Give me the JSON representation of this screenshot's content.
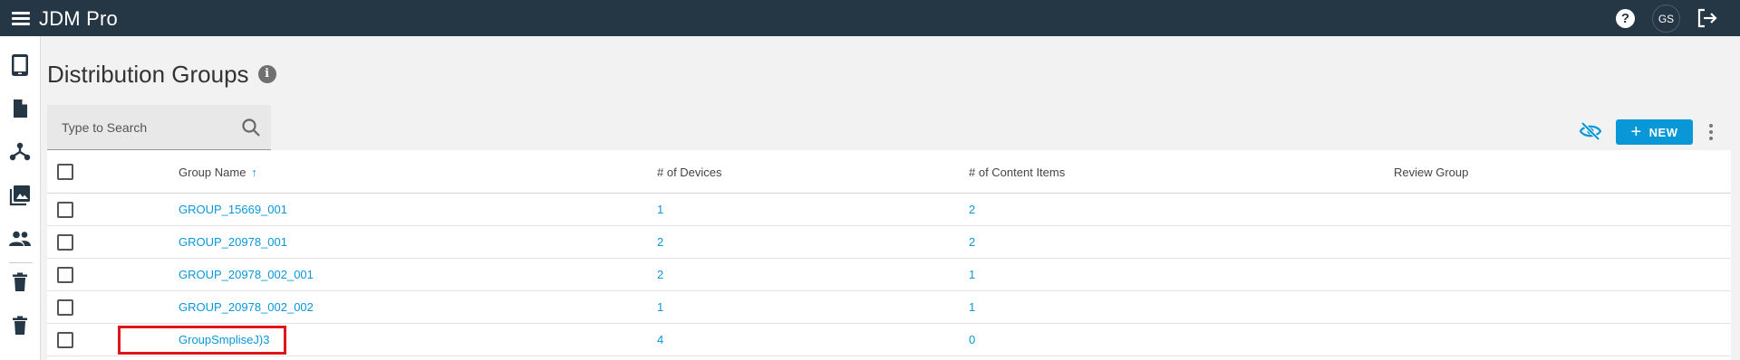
{
  "app": {
    "title": "JDM Pro",
    "avatar_initials": "GS",
    "help_label": "?"
  },
  "sidebar": {
    "items": [
      {
        "name": "devices",
        "icon": "tablet-icon"
      },
      {
        "name": "content",
        "icon": "document-icon"
      },
      {
        "name": "distribution-groups",
        "icon": "hierarchy-icon"
      },
      {
        "name": "media",
        "icon": "photo-library-icon"
      },
      {
        "name": "users",
        "icon": "people-icon"
      },
      {
        "name": "trash-1",
        "icon": "trash-icon"
      },
      {
        "name": "trash-2",
        "icon": "trash-icon"
      }
    ]
  },
  "page": {
    "title": "Distribution Groups",
    "info_label": "i"
  },
  "search": {
    "placeholder": "Type to Search",
    "value": ""
  },
  "toolbar": {
    "new_label": "NEW"
  },
  "table": {
    "headers": {
      "name": "Group Name",
      "devices": "# of Devices",
      "content": "# of Content Items",
      "review": "Review Group"
    },
    "sort": {
      "column": "Group Name",
      "direction": "ascending"
    },
    "rows": [
      {
        "name": "GROUP_15669_001",
        "devices": "1",
        "content": "2",
        "review": ""
      },
      {
        "name": "GROUP_20978_001",
        "devices": "2",
        "content": "2",
        "review": ""
      },
      {
        "name": "GROUP_20978_002_001",
        "devices": "2",
        "content": "1",
        "review": ""
      },
      {
        "name": "GROUP_20978_002_002",
        "devices": "1",
        "content": "1",
        "review": ""
      },
      {
        "name": "GroupSmpliseJ)3",
        "devices": "4",
        "content": "0",
        "review": ""
      }
    ]
  },
  "colors": {
    "topbar": "#253645",
    "accent": "#0997d8",
    "highlight": "#e0151c"
  }
}
